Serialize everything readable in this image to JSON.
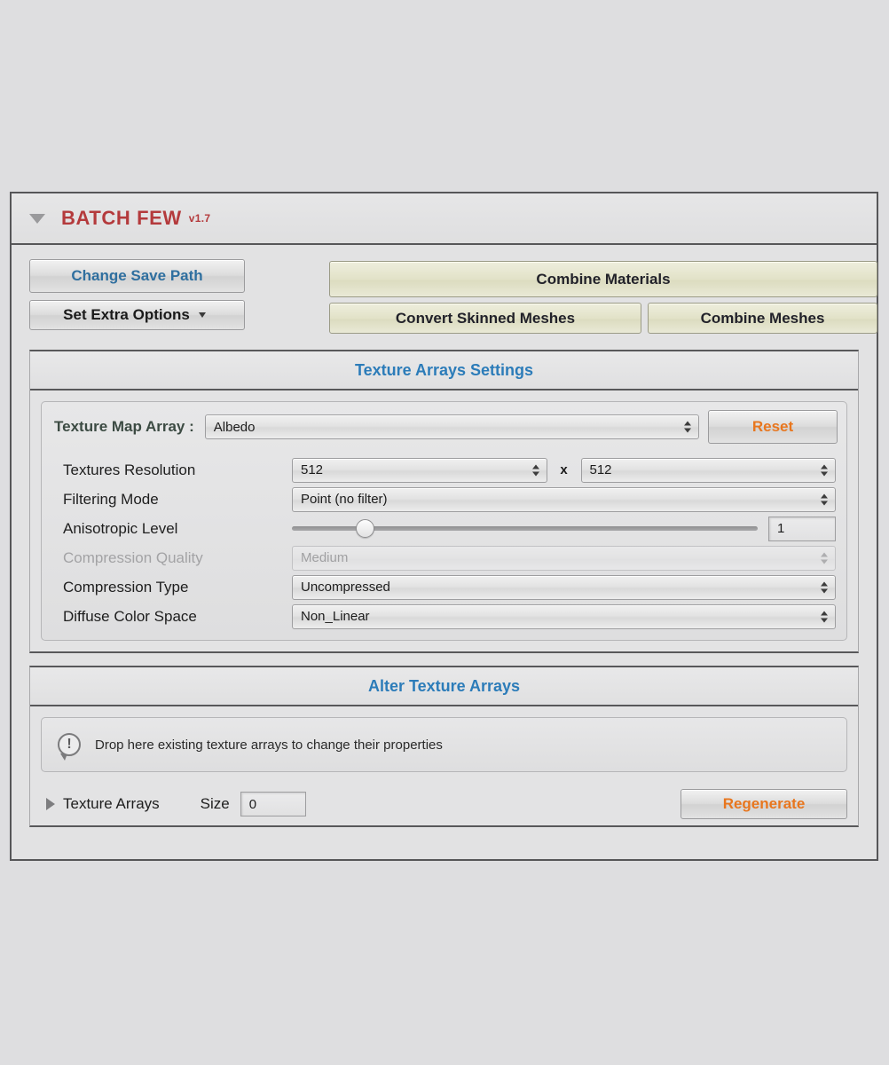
{
  "panel": {
    "title": "BATCH FEW",
    "version": "v1.7",
    "foldout_icon": "triangle-down-icon"
  },
  "toolbar": {
    "change_save_path": "Change Save Path",
    "set_extra_options": "Set Extra Options",
    "combine_materials": "Combine Materials",
    "convert_skinned_meshes": "Convert Skinned Meshes",
    "combine_meshes": "Combine Meshes"
  },
  "texture_arrays_settings": {
    "section_title": "Texture Arrays Settings",
    "map_array_label": "Texture Map Array :",
    "map_array_value": "Albedo",
    "reset_label": "Reset",
    "rows": [
      {
        "label": "Textures Resolution",
        "value": "512",
        "value2": "512",
        "separator": "x",
        "disabled": false,
        "type": "popup-pair"
      },
      {
        "label": "Filtering Mode",
        "value": "Point (no filter)",
        "disabled": false,
        "type": "popup"
      },
      {
        "label": "Anisotropic Level",
        "value": "1",
        "slider_percent": 15.5,
        "disabled": false,
        "type": "slider"
      },
      {
        "label": "Compression Quality",
        "value": "Medium",
        "disabled": true,
        "type": "popup"
      },
      {
        "label": "Compression Type",
        "value": "Uncompressed",
        "disabled": false,
        "type": "popup"
      },
      {
        "label": "Diffuse Color Space",
        "value": "Non_Linear",
        "disabled": false,
        "type": "popup"
      }
    ]
  },
  "alter_texture_arrays": {
    "section_title": "Alter Texture Arrays",
    "drop_icon": "info-bubble-icon",
    "drop_text": "Drop here existing texture arrays to change their properties",
    "list_label": "Texture Arrays",
    "list_foldout_icon": "triangle-right-icon",
    "size_label": "Size",
    "size_value": "0",
    "regenerate_label": "Regenerate"
  },
  "colors": {
    "title_red": "#b43a3c",
    "section_blue": "#2c7cb9",
    "link_blue": "#2f6f9f",
    "accent_orange": "#e8761e",
    "map_label_green": "#3c4b43",
    "panel_bg": "#e2e2e3",
    "page_bg": "#dedee0",
    "khaki_button": "#e2e2c8"
  }
}
